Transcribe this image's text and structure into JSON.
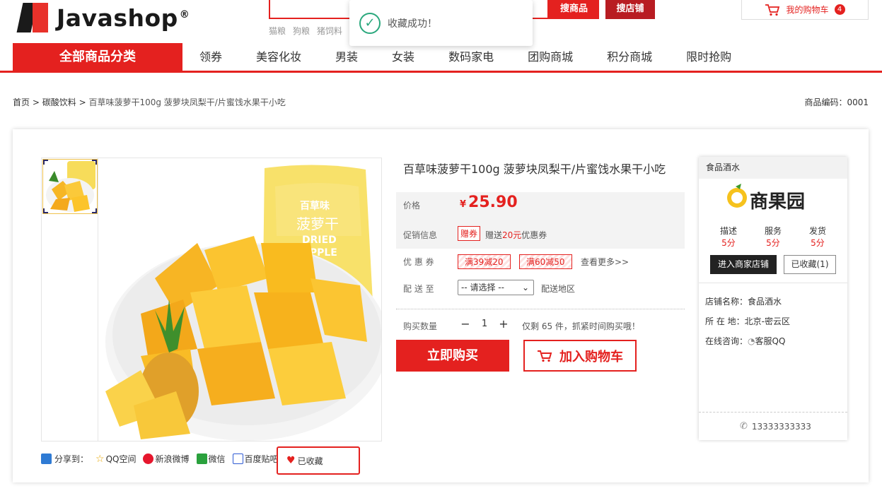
{
  "header": {
    "logo_text": "Javashop",
    "logo_reg": "®",
    "search_goods_label": "搜商品",
    "search_shop_label": "搜店铺",
    "hot_words": [
      "猫粮",
      "狗粮",
      "猪饲料"
    ],
    "cart_label": "我的购物车",
    "cart_count": "4"
  },
  "toast": {
    "message": "收藏成功！"
  },
  "nav": {
    "all_categories": "全部商品分类",
    "items": [
      "领券",
      "美容化妆",
      "男装",
      "女装",
      "数码家电",
      "团购商城",
      "积分商城",
      "限时抢购"
    ]
  },
  "breadcrumb": {
    "home": "首页",
    "sep": ">",
    "category": "碳酸饮料",
    "current": "百草味菠萝干100g 菠萝块凤梨干/片蜜饯水果干小吃"
  },
  "goods_code": "商品编码：0001",
  "product": {
    "title": "百草味菠萝干100g 菠萝块凤梨干/片蜜饯水果干小吃",
    "price_label": "价格",
    "currency": "¥",
    "price": "25.90",
    "promo_label": "促销信息",
    "promo_tag": "赠券",
    "promo_text_a": "赠送",
    "promo_amount": "20元",
    "promo_text_b": "优惠券",
    "coupon_label": "优 惠 券",
    "coupons": [
      "满39减20",
      "满60减50"
    ],
    "coupon_more": "查看更多>>",
    "delivery_label": "配 送 至",
    "delivery_select": "-- 请选择 --",
    "delivery_area": "配送地区",
    "qty_label": "购买数量",
    "qty_value": "1",
    "stock_text": "仅剩 65 件，抓紧时间购买哦！",
    "buy_now": "立即购买",
    "add_to_cart": "加入购物车",
    "package_words_a": "菠萝干",
    "package_words_b": "DRIED",
    "package_words_c": "APPLE",
    "package_brand": "百草味"
  },
  "share": {
    "label": "分享到：",
    "items": [
      "QQ空间",
      "新浪微博",
      "微信",
      "百度贴吧"
    ],
    "favorited": "已收藏"
  },
  "shop": {
    "name_head": "食品酒水",
    "logo_text": "商果园",
    "scores": [
      {
        "label": "描述",
        "value": "5分"
      },
      {
        "label": "服务",
        "value": "5分"
      },
      {
        "label": "发货",
        "value": "5分"
      }
    ],
    "enter_btn": "进入商家店铺",
    "faved_btn": "已收藏(1)",
    "info_name_label": "店铺名称：",
    "info_name": "食品酒水",
    "info_loc_label": "所 在 地：",
    "info_loc": "北京-密云区",
    "info_chat_label": "在线咨询：",
    "info_chat": "客服QQ",
    "phone": "13333333333"
  },
  "colors": {
    "brand_red": "#e4211f",
    "success_green": "#2aa87d"
  }
}
